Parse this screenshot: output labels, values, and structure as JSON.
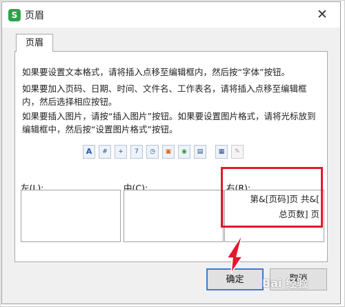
{
  "window": {
    "app_icon": "S",
    "title": "页眉",
    "close": "✕"
  },
  "tab": {
    "label": "页眉"
  },
  "instructions": {
    "p1": "如果要设置文本格式，请将插入点移至编辑框内，然后按“字体”按钮。",
    "p2": "如果要加入页码、日期、时间、文件名、工作表名，请将插入点移至编辑框内，然后选择相应按钮。",
    "p3": "如果要插入图片，请按“插入图片”按钮。如果要设置图片格式，请将光标放到编辑框中，然后按“设置图片格式”按钮。"
  },
  "toolbar": {
    "buttons": [
      {
        "icon": "font-icon",
        "glyph": "A"
      },
      {
        "icon": "page-number-icon",
        "glyph": "#"
      },
      {
        "icon": "total-pages-icon",
        "glyph": "+"
      },
      {
        "icon": "date-icon",
        "glyph": "7"
      },
      {
        "icon": "time-icon",
        "glyph": "◷"
      },
      {
        "icon": "file-path-icon",
        "glyph": "▣"
      },
      {
        "icon": "file-name-icon",
        "glyph": "◉"
      },
      {
        "icon": "sheet-name-icon",
        "glyph": "▤"
      },
      {
        "icon": "insert-picture-icon",
        "glyph": "▦"
      },
      {
        "icon": "format-picture-icon",
        "glyph": "✎"
      }
    ]
  },
  "sections": {
    "left_label": "左(L):",
    "center_label": "中(C):",
    "right_label": "右(R):",
    "right_line1": "第&[页码]页 共&[",
    "right_line2": "总页数] 页"
  },
  "buttons": {
    "ok": "确定",
    "cancel": "取消"
  },
  "colors": {
    "highlight_red": "#e3172d",
    "ok_focus": "#3b7bd4"
  },
  "watermark": "Bai 经验"
}
